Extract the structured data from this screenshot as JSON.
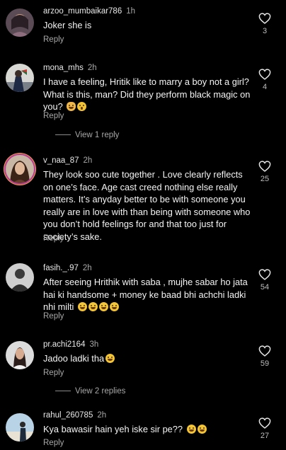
{
  "colors": {
    "background": "#000000",
    "text": "#f5f5f5",
    "secondary_text": "#a8a8a8",
    "story_ring": "#b83a9c",
    "emoji": "#f3c435"
  },
  "icons": {
    "like": "heart-outline-icon",
    "emoji_laugh": "face-with-tears-of-joy",
    "emoji_shock": "face-screaming",
    "emoji_pray": "folded-hands",
    "emoji_smile": "smiling-face"
  },
  "comments": [
    {
      "username": "arzoo_mumbaikar786",
      "time": "1h",
      "text": "Joker she is",
      "reply_label": "Reply",
      "likes": "3"
    },
    {
      "username": "mona_mhs",
      "time": "2h",
      "text": "I have a feeling, Hritik like to marry a boy  not a girl? What is this, man? Did they perform black magic on you?",
      "reply_label": "Reply",
      "likes": "4",
      "view_replies": "View 1 reply"
    },
    {
      "username": "v_naa_87",
      "time": "2h",
      "text": "They look soo cute together . Love clearly reflects on one’s face. Age cast creed nothing else really matters. It’s anyday better to be with someone you really are in love with than being with someone who you don’t hold feelings for and that too just for society’s sake.",
      "reply_label": "Reply",
      "likes": "25"
    },
    {
      "username": "fasih._.97",
      "time": "2h",
      "text": "After seeing Hrithik with saba , mujhe sabar ho jata hai ki handsome + money ke baad bhi achchi ladki nhi milti",
      "reply_label": "Reply",
      "likes": "54"
    },
    {
      "username": "pr.achi2164",
      "time": "3h",
      "text": "Jadoo ladki tha",
      "reply_label": "Reply",
      "likes": "59",
      "view_replies": "View 2 replies"
    },
    {
      "username": "rahul_260785",
      "time": "2h",
      "text": "Kya bawasir hain yeh iske sir pe??",
      "reply_label": "Reply",
      "likes": "27"
    }
  ]
}
